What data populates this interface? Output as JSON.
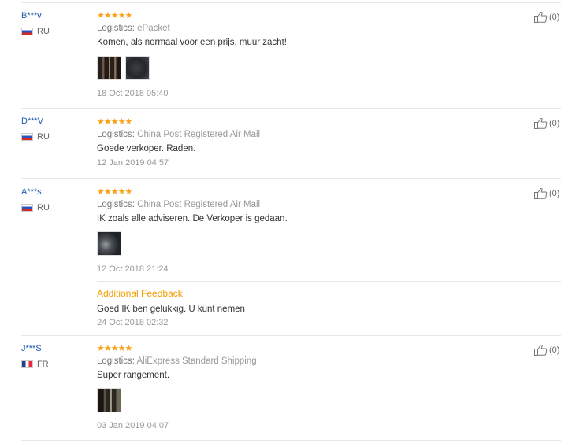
{
  "reviews": [
    {
      "user": "B***v",
      "country": "RU",
      "stars": "★★★★★",
      "logistics_label": "Logistics:",
      "logistics_value": "ePacket",
      "text": "Komen, als normaal voor een prijs, muur zacht!",
      "date": "18 Oct 2018 05:40",
      "likes": "(0)"
    },
    {
      "user": "D***V",
      "country": "RU",
      "stars": "★★★★★",
      "logistics_label": "Logistics:",
      "logistics_value": "China Post Registered Air Mail",
      "text": "Goede verkoper. Raden.",
      "date": "12 Jan 2019 04:57",
      "likes": "(0)"
    },
    {
      "user": "A***s",
      "country": "RU",
      "stars": "★★★★★",
      "logistics_label": "Logistics:",
      "logistics_value": "China Post Registered Air Mail",
      "text": "IK zoals alle adviseren. De Verkoper is gedaan.",
      "date": "12 Oct 2018 21:24",
      "likes": "(0)",
      "additional_label": "Additional Feedback",
      "additional_text": "Goed IK ben gelukkig. U kunt nemen",
      "additional_date": "24 Oct 2018 02:32"
    },
    {
      "user": "J***S",
      "country": "FR",
      "stars": "★★★★★",
      "logistics_label": "Logistics:",
      "logistics_value": "AliExpress Standard Shipping",
      "text": "Super rangement.",
      "date": "03 Jan 2019 04:07",
      "likes": "(0)"
    }
  ],
  "icons": {
    "like": "thumbs-up-icon",
    "flag_ru": "russia-flag-icon",
    "flag_fr": "france-flag-icon"
  },
  "colors": {
    "username": "#1e5aa8",
    "stars": "#f7a21b",
    "additional_feedback": "#f39c00"
  }
}
